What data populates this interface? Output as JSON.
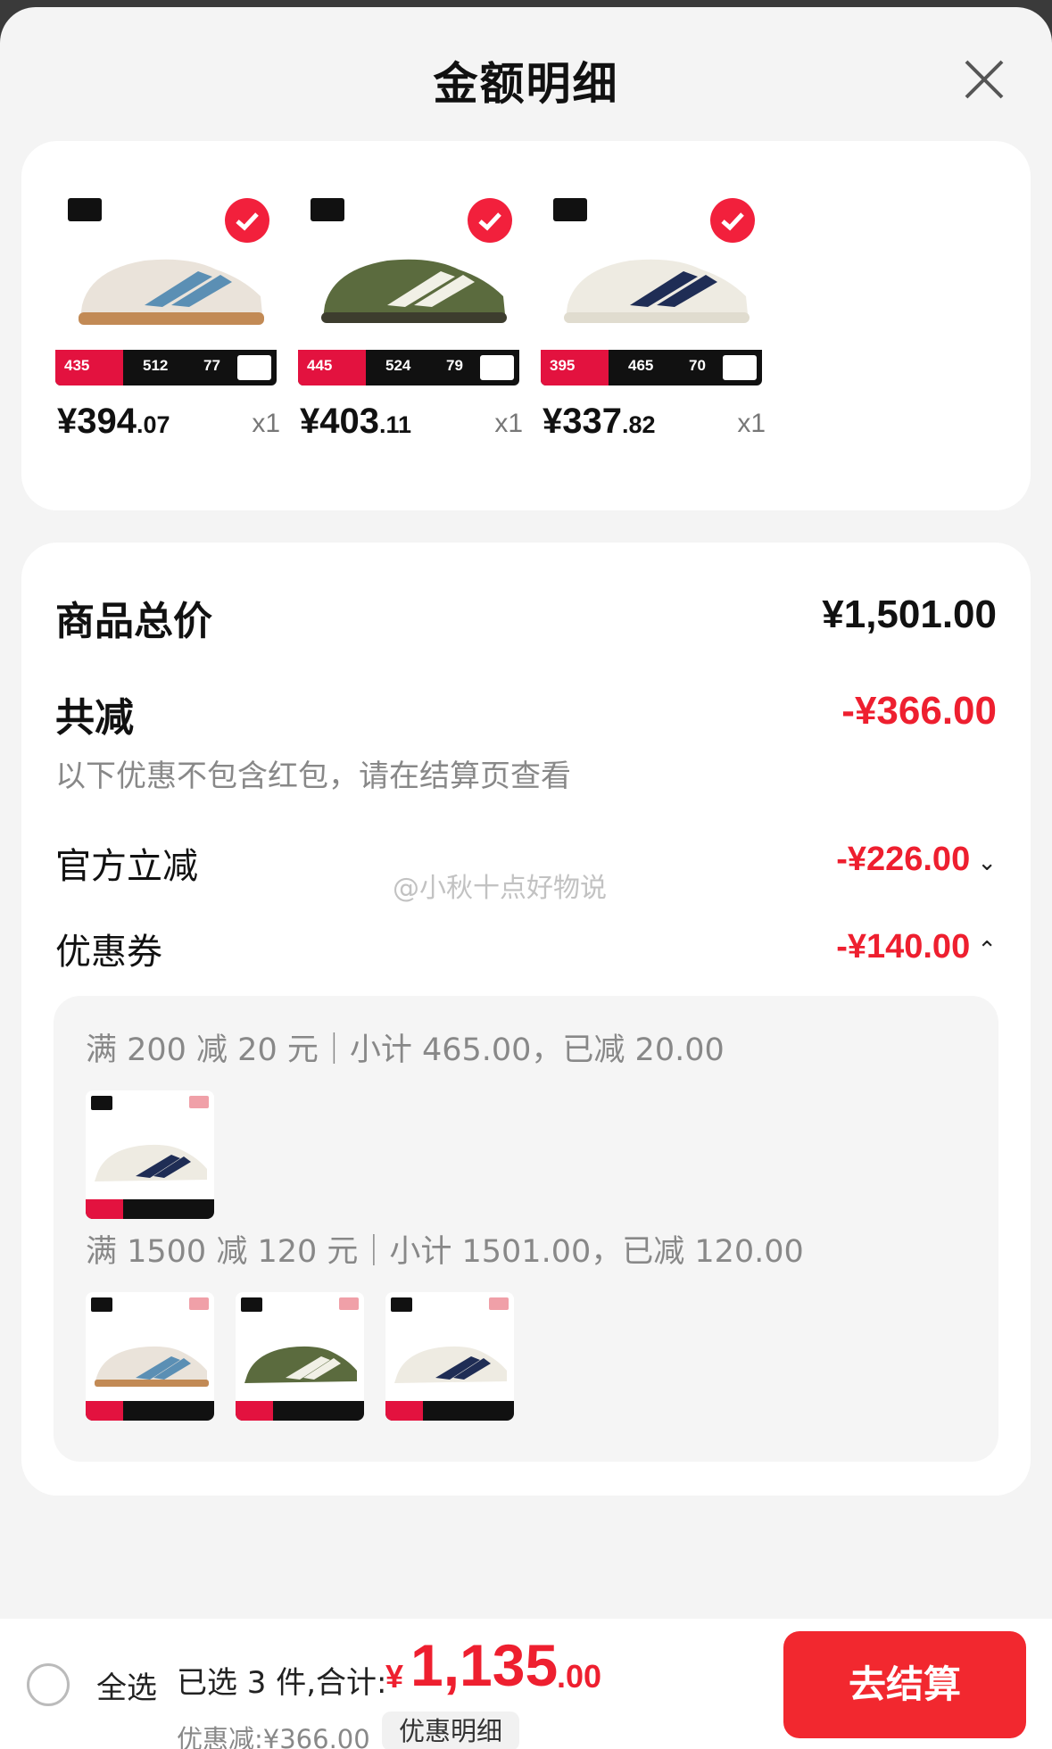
{
  "title": "金额明细",
  "products": [
    {
      "price_int": "¥394",
      "price_dec": ".07",
      "qty": "x1",
      "banner_price": "435",
      "banner_a": "512",
      "banner_b": "77",
      "upper": "#eae3da",
      "stripe": "#5b8fb4",
      "sole": "#c28a55"
    },
    {
      "price_int": "¥403",
      "price_dec": ".11",
      "qty": "x1",
      "banner_price": "445",
      "banner_a": "524",
      "banner_b": "79",
      "upper": "#5b6b3e",
      "stripe": "#f1f0e6",
      "sole": "#3d3d2e"
    },
    {
      "price_int": "¥337",
      "price_dec": ".82",
      "qty": "x1",
      "banner_price": "395",
      "banner_a": "465",
      "banner_b": "70",
      "upper": "#eeebe2",
      "stripe": "#1f2d55",
      "sole": "#e9e6dc"
    }
  ],
  "summary": {
    "total_label": "商品总价",
    "total_value": "¥1,501.00",
    "reduce_label": "共减",
    "reduce_value": "-¥366.00",
    "note": "以下优惠不包含红包，请在结算页查看",
    "official_label": "官方立减",
    "official_value": "-¥226.00",
    "coupon_label": "优惠券",
    "coupon_value": "-¥140.00"
  },
  "coupons": [
    {
      "line": "满 200 减 20 元｜小计 465.00，已减 20.00"
    },
    {
      "line": "满 1500 减 120 元｜小计 1501.00，已减 120.00"
    }
  ],
  "watermark": "@小秋十点好物说",
  "bottom": {
    "select_all": "全选",
    "selected": "已选 3 件,合计:",
    "currency": "¥",
    "total_int": "1,135",
    "total_dec": ".00",
    "discount": "优惠减:¥366.00",
    "detail": "优惠明细",
    "checkout": "去结算"
  },
  "colors": {
    "accent": "#ee1f2f",
    "checkout": "#f2282f"
  }
}
